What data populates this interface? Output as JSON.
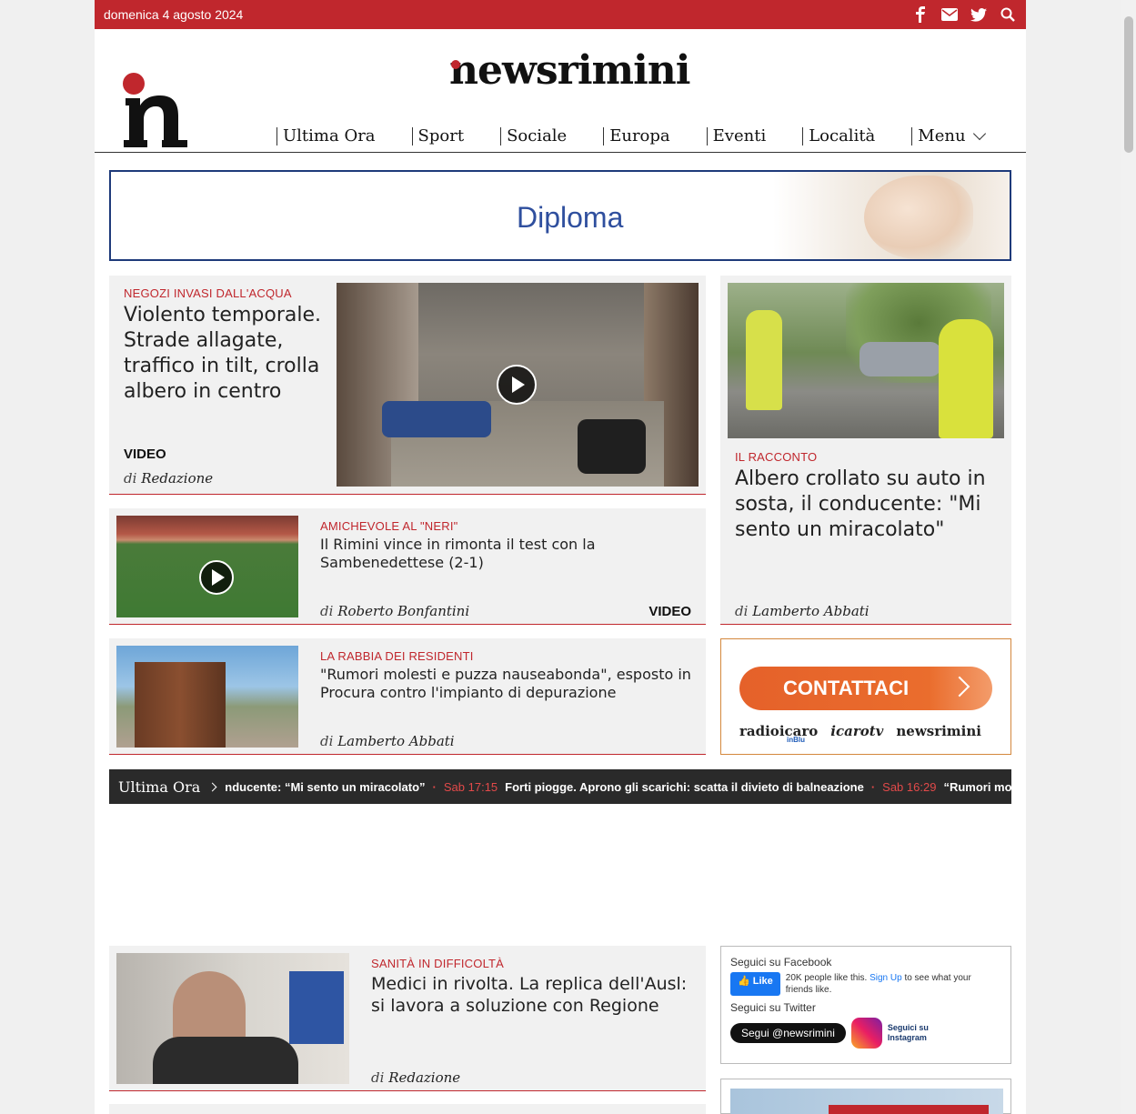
{
  "topbar": {
    "date": "domenica 4 agosto 2024",
    "icons": [
      "facebook-icon",
      "mail-icon",
      "twitter-icon",
      "search-icon"
    ]
  },
  "brand": {
    "name": "newsrimini",
    "logo_letter": "n"
  },
  "nav": [
    "Ultima Ora",
    "Sport",
    "Sociale",
    "Europa",
    "Eventi",
    "Località",
    "Menu"
  ],
  "banner": {
    "text": "Diploma"
  },
  "articles": {
    "a1": {
      "kicker": "NEGOZI INVASI DALL'ACQUA",
      "title": "Violento temporale. Strade allagate, traffico in tilt, crolla albero in centro",
      "tag": "VIDEO",
      "by": "di",
      "author": "Redazione"
    },
    "a2": {
      "kicker": "IL RACCONTO",
      "title": "Albero crollato su auto in sosta, il conducente: \"Mi sento un miracolato\"",
      "by": "di",
      "author": "Lamberto Abbati"
    },
    "a3": {
      "kicker": "AMICHEVOLE AL \"NERI\"",
      "title": "Il Rimini vince in rimonta il test con la Sambenedettese (2-1)",
      "tag": "VIDEO",
      "by": "di",
      "author": "Roberto Bonfantini"
    },
    "a4": {
      "kicker": "LA RABBIA DEI RESIDENTI",
      "title": "\"Rumori molesti e puzza nauseabonda\", esposto in Procura contro l'impianto di depurazione",
      "by": "di",
      "author": "Lamberto Abbati"
    },
    "a5": {
      "kicker": "SANITÀ IN DIFFICOLTÀ",
      "title": "Medici in rivolta. La replica dell'Ausl: si lavora a soluzione con Regione",
      "by": "di",
      "author": "Redazione"
    }
  },
  "sponsor": {
    "button": "CONTATTACI",
    "brands": [
      "radioicaro",
      "icarotv",
      "newsrimini"
    ],
    "sub": "inBlu"
  },
  "ticker": {
    "label": "Ultima Ora",
    "items": [
      {
        "time": "",
        "text": "nducente: “Mi sento un miracolato”"
      },
      {
        "time": "Sab 17:15",
        "text": "Forti piogge. Aprono gli scarichi: scatta il divieto di balneazione"
      },
      {
        "time": "Sab 16:29",
        "text": "“Rumori mo"
      }
    ]
  },
  "social": {
    "fb_title": "Seguici su Facebook",
    "fb_like": "Like",
    "fb_text_1": "20K people like this.",
    "fb_signup": "Sign Up",
    "fb_text_2": "to see what your friends like.",
    "tw_title": "Seguici su Twitter",
    "tw_button": "Segui @newsrimini",
    "ig_text": "Seguici su Instagram"
  },
  "colors": {
    "accent": "#c0272d",
    "dark": "#2a2a2a"
  }
}
